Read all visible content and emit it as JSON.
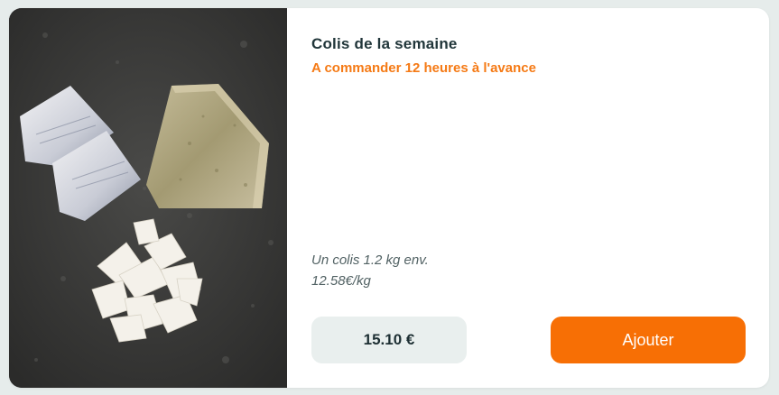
{
  "product": {
    "title": "Colis de la semaine",
    "subtitle": "A commander 12 heures à l'avance",
    "description_line1": "Un colis 1.2 kg env.",
    "description_line2": "12.58€/kg",
    "price": "15.10 €",
    "add_label": "Ajouter"
  },
  "colors": {
    "accent": "#f76f05",
    "subtitle": "#f57a15",
    "title": "#21363a",
    "price_bg": "#e9efee"
  },
  "image": {
    "subject": "fish-fillet-photo"
  }
}
